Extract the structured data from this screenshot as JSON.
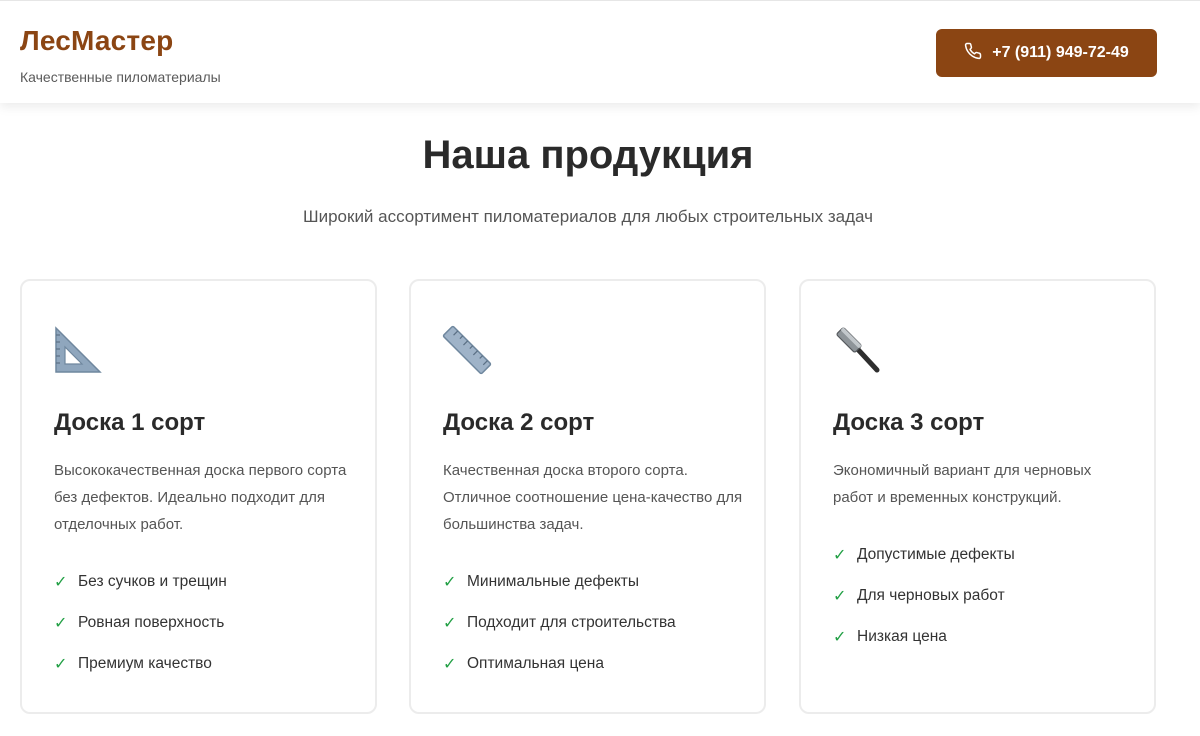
{
  "header": {
    "logo": "ЛесМастер",
    "tagline": "Качественные пиломатериалы",
    "phone": "+7 (911) 949-72-49"
  },
  "section": {
    "title": "Наша продукция",
    "subtitle": "Широкий ассортимент пиломатериалов для любых строительных задач"
  },
  "products": [
    {
      "icon": "triangular-ruler-icon",
      "title": "Доска 1 сорт",
      "description": "Высококачественная доска первого сорта без дефектов. Идеально подходит для отделочных работ.",
      "features": [
        "Без сучков и трещин",
        "Ровная поверхность",
        "Премиум качество"
      ]
    },
    {
      "icon": "straight-ruler-icon",
      "title": "Доска 2 сорт",
      "description": "Качественная доска второго сорта. Отличное соотношение цена-качество для большинства задач.",
      "features": [
        "Минимальные дефекты",
        "Подходит для строительства",
        "Оптимальная цена"
      ]
    },
    {
      "icon": "hammer-icon",
      "title": "Доска 3 сорт",
      "description": "Экономичный вариант для черновых работ и временных конструкций.",
      "features": [
        "Допустимые дефекты",
        "Для черновых работ",
        "Низкая цена"
      ]
    }
  ],
  "colors": {
    "brand": "#8b4513",
    "check": "#22a045",
    "text": "#2a2a2a",
    "muted": "#555555"
  },
  "check_glyph": "✓"
}
